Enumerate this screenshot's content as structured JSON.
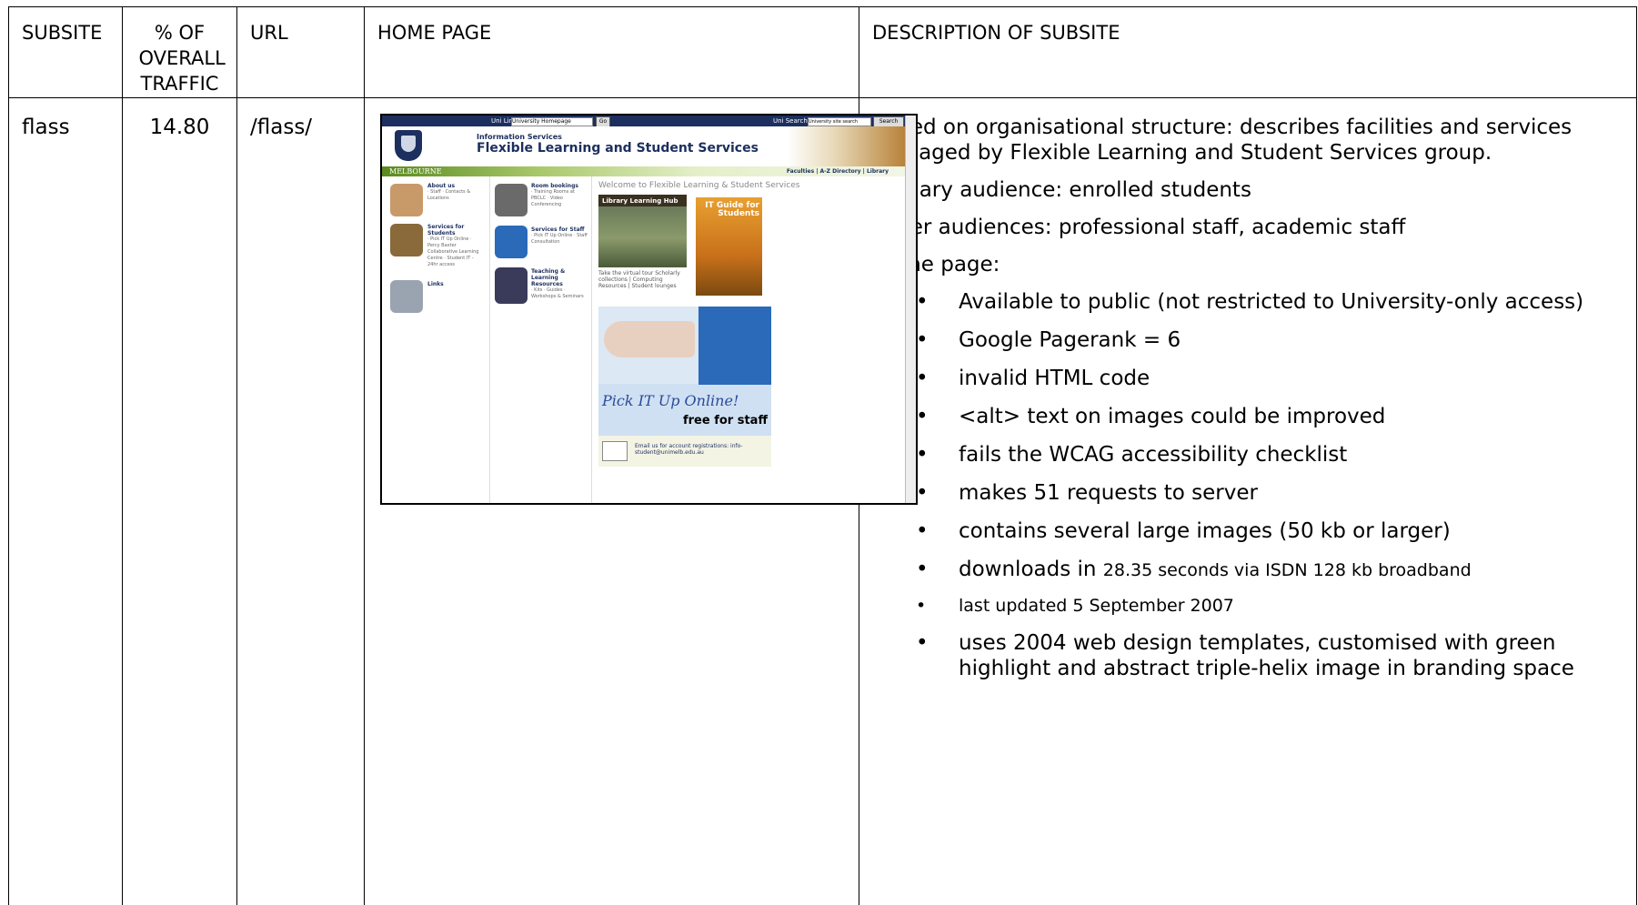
{
  "headers": {
    "subsite": "SUBSITE",
    "traffic": "% OF OVERALL TRAFFIC",
    "url": "URL",
    "home_page": "HOME PAGE",
    "description": "DESCRIPTION OF SUBSITE"
  },
  "row": {
    "subsite": "flass",
    "traffic": "14.80",
    "url": "/flass/",
    "description": {
      "intro": "Based on organisational structure: describes facilities and services managed by Flexible Learning and Student Services group.",
      "primary_audience": "Primary audience: enrolled students",
      "other_audiences": "Other audiences: professional staff, academic staff",
      "home_page_label": "Home page:",
      "bullets": [
        "Available to public (not restricted to University-only access)",
        "Google Pagerank = 6",
        "invalid HTML code",
        "<alt> text on images could be improved",
        "fails the WCAG accessibility checklist",
        "makes 51 requests to server",
        "contains several large images (50 kb or larger)"
      ],
      "download_prefix": "downloads in",
      "download_suffix": "28.35 seconds via ISDN 128 kb broadband",
      "last_updated": "last updated 5 September 2007",
      "template_note": "uses 2004 web design templates, customised with green highlight and abstract triple-helix image in branding space"
    }
  },
  "screenshot": {
    "uni_links": "Uni Links:",
    "uni_links_value": "University Homepage",
    "go": "Go",
    "uni_search": "Uni Search:",
    "search_value": "University site search",
    "search_btn": "Search",
    "sub": "Information Services",
    "title": "Flexible Learning and Student Services",
    "melbourne": "MELBOURNE",
    "top_links": "Faculties | A-Z Directory | Library",
    "welcome": "Welcome to Flexible Learning & Student Services",
    "about_us": "About us",
    "about_links": "· Staff · Contacts & Locations",
    "services_students": "Services for Students",
    "students_links": "· Pick IT Up Online · Percy Baxter Collaborative Learning Centre · Student IT - 24hr access",
    "links": "Links",
    "room_bookings": "Room bookings",
    "room_links": "· Training Rooms at PBCLC · Video Conferencing",
    "services_staff": "Services for Staff",
    "staff_links": "· Pick IT Up Online · Staff Consultation",
    "teaching": "Teaching & Learning Resources",
    "teaching_links": "· Kits · Guides · Workshops & Seminars",
    "hub": "Library Learning Hub",
    "it_guide": "IT Guide for Students",
    "tour": "Take the virtual tour Scholarly collections | Computing Resources | Student lounges",
    "pick": "Pick IT Up Online!",
    "free": "free for staff",
    "email": "Email us for account registrations: info-student@unimelb.edu.au"
  }
}
